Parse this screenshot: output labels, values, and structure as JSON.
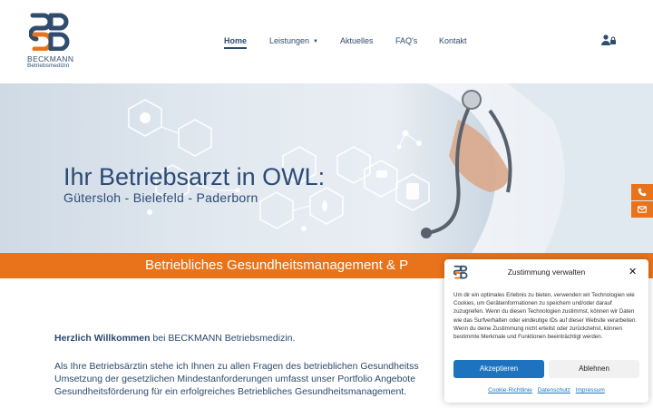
{
  "brand": {
    "name": "BECKMANN",
    "subtitle": "Betriebsmedizin",
    "colors": {
      "navy": "#2f4c6d",
      "orange": "#e9731a",
      "blue": "#1e73be"
    }
  },
  "nav": {
    "items": [
      {
        "label": "Home",
        "active": true
      },
      {
        "label": "Leistungen",
        "has_dropdown": true
      },
      {
        "label": "Aktuelles"
      },
      {
        "label": "FAQ's"
      },
      {
        "label": "Kontakt"
      }
    ],
    "user_icon": "user-lock-icon"
  },
  "hero": {
    "title": "Ihr Betriebsarzt in OWL:",
    "subtitle": "Gütersloh - Bielefeld - Paderborn"
  },
  "band": {
    "text": "Betriebliches Gesundheitsmanagement & P"
  },
  "side_tabs": [
    {
      "icon": "phone-icon"
    },
    {
      "icon": "mail-icon"
    }
  ],
  "content": {
    "welcome_bold": "Herzlich Willkommen",
    "welcome_rest": " bei BECKMANN Betriebsmedizin.",
    "paragraph_lines": [
      "Als Ihre Betriebsärztin stehe ich Ihnen zu allen Fragen des betrieblichen Gesundheitss",
      "Umsetzung der gesetzlichen Mindestanforderungen umfasst unser Portfolio Angebote",
      "Gesundheitsförderung für ein erfolgreiches Betriebliches Gesundheitsmanagement."
    ]
  },
  "consent": {
    "title": "Zustimmung verwalten",
    "body": "Um dir ein optimales Erlebnis zu bieten, verwenden wir Technologien wie Cookies, um Geräteinformationen zu speichern und/oder darauf zuzugreifen. Wenn du diesen Technologien zustimmst, können wir Daten wie das Surfverhalten oder eindeutige IDs auf dieser Website verarbeiten. Wenn du deine Zustimmung nicht erteilst oder zurückziehst, können bestimmte Merkmale und Funktionen beeinträchtigt werden.",
    "accept_label": "Akzeptieren",
    "decline_label": "Ablehnen",
    "links": [
      "Cookie-Richtlinie",
      "Datenschutz",
      "Impressum"
    ]
  }
}
